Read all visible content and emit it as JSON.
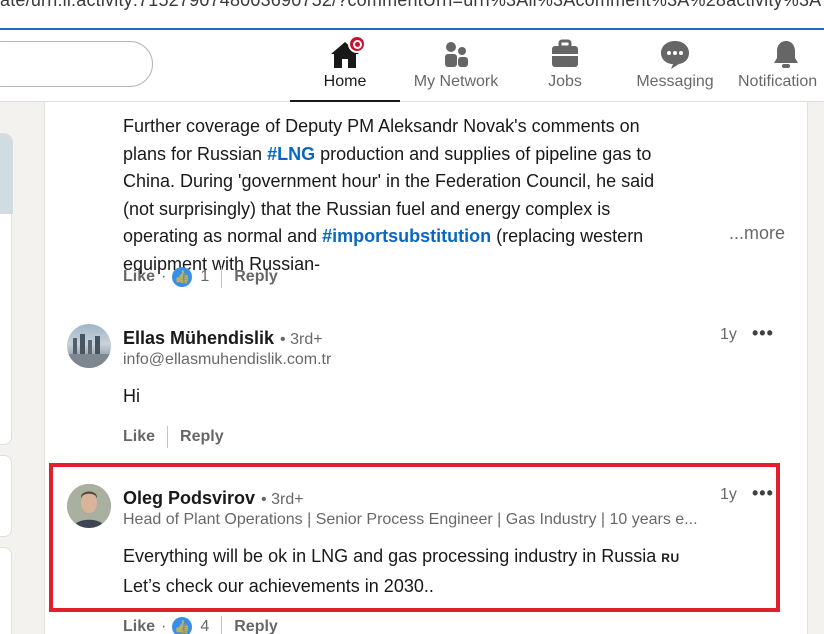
{
  "browser": {
    "url_fragment": "ate/urn:li:activity:7152790748003690752/?commentUrn=urn%3Ali%3Acomment%3A%28activity%3A7152790"
  },
  "nav": {
    "items": [
      {
        "label": "Home",
        "icon": "home-icon",
        "active": true
      },
      {
        "label": "My Network",
        "icon": "people-icon"
      },
      {
        "label": "Jobs",
        "icon": "briefcase-icon"
      },
      {
        "label": "Messaging",
        "icon": "chat-icon"
      },
      {
        "label": "Notification",
        "icon": "bell-icon"
      }
    ]
  },
  "post": {
    "text_parts": [
      "Further coverage of Deputy PM Aleksandr Novak's comments on plans for Russian ",
      "#LNG",
      " production and supplies of pipeline gas to China. During 'government hour' in the Federation Council, he said (not surprisingly) that the Russian fuel and energy complex is operating as normal and ",
      "#importsubstitution",
      " (replacing western equipment with Russian-"
    ],
    "more_label": "...more",
    "actions": {
      "like": "Like",
      "dot": "·",
      "count": "1",
      "reply": "Reply"
    }
  },
  "comments": [
    {
      "name": "Ellas Mühendislik",
      "degree": "• 3rd+",
      "subtitle": "info@ellasmuhendislik.com.tr",
      "time": "1y",
      "menu": "•••",
      "text": "Hi",
      "actions": {
        "like": "Like",
        "reply": "Reply"
      }
    },
    {
      "name": "Oleg Podsvirov",
      "degree": "• 3rd+",
      "subtitle": "Head of Plant Operations | Senior Process Engineer | Gas Industry | 10 years e...",
      "time": "1y",
      "menu": "•••",
      "text_line1": "Everything will be ok in LNG and gas processing industry in Russia",
      "flag": "RU",
      "text_line2": "Let’s check our achievements in 2030..",
      "actions": {
        "like": "Like",
        "dot": "·",
        "count": "4",
        "reply": "Reply"
      }
    }
  ],
  "colors": {
    "brand": "#0a66c2",
    "highlight": "#e0202c",
    "badge": "#cb112d"
  }
}
